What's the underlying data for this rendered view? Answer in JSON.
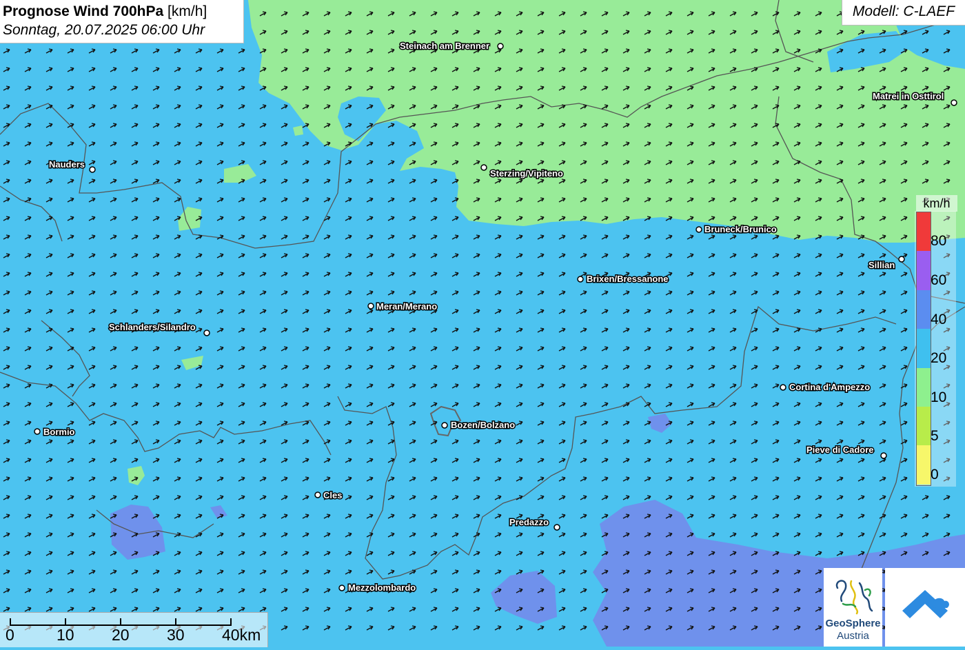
{
  "title": {
    "bold": "Prognose Wind 700hPa",
    "unit": "[km/h]",
    "datetime": "Sonntag, 20.07.2025 06:00 Uhr"
  },
  "model": "Modell: C-LAEF",
  "legend": {
    "unit": "km/h",
    "labels": [
      "80",
      "60",
      "40",
      "20",
      "10",
      "5",
      "0"
    ],
    "colors": [
      "#f03a3a",
      "#9a5ef0",
      "#5b8df0",
      "#3fc0ef",
      "#8ef08e",
      "#b8ec4a",
      "#f7f76a"
    ]
  },
  "colors": {
    "zone_20_40": "#4cc3f0",
    "zone_10_20": "#98eb98",
    "zone_40_60": "#6f91ec",
    "zone_5_10": "#b8ec4a",
    "zone_dark": "#1e6fd6",
    "border": "#555555"
  },
  "cities": [
    {
      "name": "Steinach am Brenner"
    },
    {
      "name": "Matrei in Osttirol"
    },
    {
      "name": "Nauders"
    },
    {
      "name": "Sterzing/Vipiteno"
    },
    {
      "name": "Bruneck/Brunico"
    },
    {
      "name": "Sillian"
    },
    {
      "name": "Brixen/Bressanone"
    },
    {
      "name": "Meran/Merano"
    },
    {
      "name": "Schlanders/Silandro"
    },
    {
      "name": "Cortina d'Ampezzo"
    },
    {
      "name": "Bozen/Bolzano"
    },
    {
      "name": "Bormio"
    },
    {
      "name": "Pieve di Cadore"
    },
    {
      "name": "Cles"
    },
    {
      "name": "Predazzo"
    },
    {
      "name": "Mezzolombardo"
    }
  ],
  "scale": {
    "labels": [
      "0",
      "10",
      "20",
      "30",
      "40km"
    ]
  },
  "logo": {
    "line1": "GeoSphere",
    "line2": "Austria"
  }
}
